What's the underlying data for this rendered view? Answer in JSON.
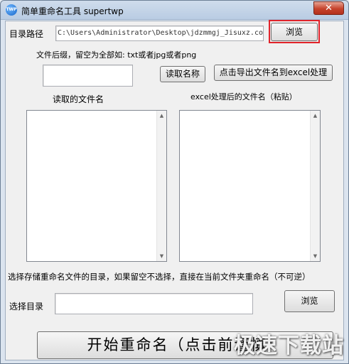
{
  "window": {
    "title": "简单重命名工具 supertwp",
    "icon_text": "TWP",
    "close_glyph": "✕"
  },
  "directory": {
    "label": "目录路径",
    "path_value": "C:\\Users\\Administrator\\Desktop\\jdzmmgj_Jisuxz.com",
    "browse_label": "浏览"
  },
  "suffix": {
    "hint": "文件后缀，留空为全部如: txt或者jpg或者png",
    "value": "",
    "read_names_label": "读取名称",
    "export_label": "点击导出文件名到excel处理"
  },
  "lists": {
    "read_names_title": "读取的文件名",
    "excel_names_title": "excel处理后的文件名（粘贴）"
  },
  "output": {
    "hint": "选择存储重命名文件的目录，如果留空不选择，直接在当前文件夹重命名（不可逆）",
    "label": "选择目录",
    "value": "",
    "browse_label": "浏览"
  },
  "start_button_label": "开始重命名（点击前谨慎）",
  "watermark": "极速下载站",
  "colors": {
    "highlight_border": "#e0232a"
  }
}
